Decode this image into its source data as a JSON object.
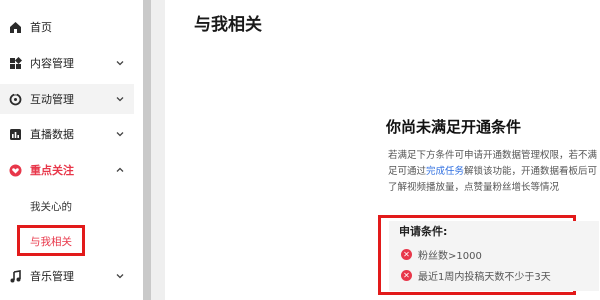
{
  "sidebar": {
    "items": [
      {
        "label": "首页",
        "icon": "home-icon"
      },
      {
        "label": "内容管理",
        "icon": "content-icon"
      },
      {
        "label": "互动管理",
        "icon": "interaction-icon"
      },
      {
        "label": "直播数据",
        "icon": "chart-icon"
      },
      {
        "label": "重点关注",
        "icon": "heart-icon"
      },
      {
        "label": "音乐管理",
        "icon": "music-icon"
      }
    ],
    "subitems": [
      {
        "label": "我关心的"
      },
      {
        "label": "与我相关"
      }
    ]
  },
  "main": {
    "page_title": "与我相关",
    "card": {
      "title": "你尚未满足开通条件",
      "desc_before": "若满足下方条件可申请开通数据管理权限，若不满足可通过",
      "desc_link": "完成任务",
      "desc_after": "解锁该功能，开通数据看板后可了解视频播放量，点赞量粉丝增长等情况",
      "conditions_title": "申请条件:",
      "conditions": [
        {
          "text": "粉丝数>1000"
        },
        {
          "text": "最近1周内投稿天数不少于3天"
        }
      ]
    }
  },
  "colors": {
    "accent": "#e8374a",
    "link": "#2f6fe0",
    "highlight_box": "#e21a1a"
  }
}
